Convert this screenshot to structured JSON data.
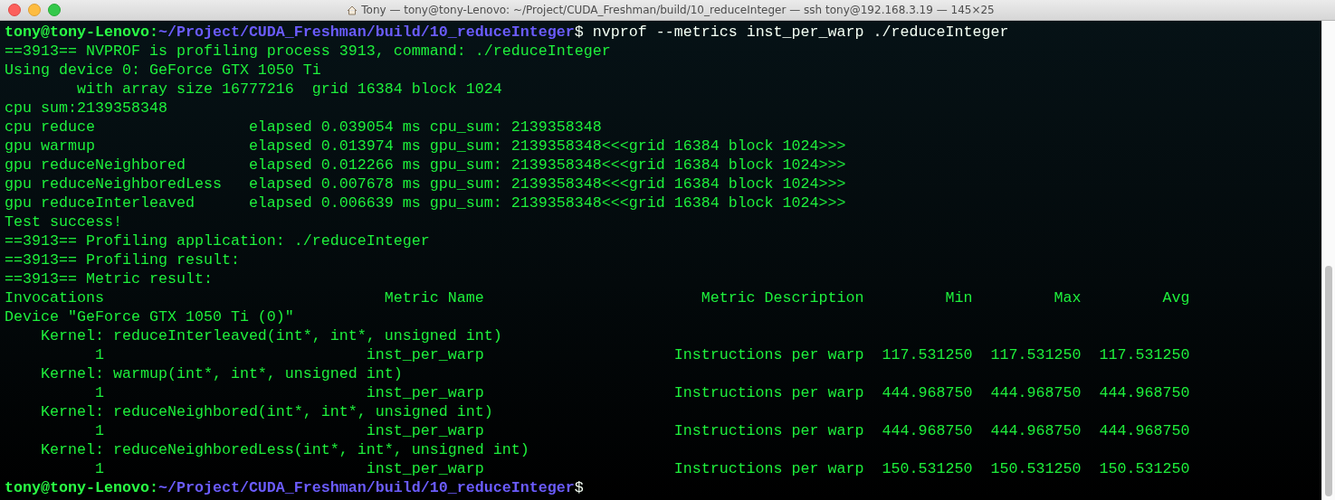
{
  "window": {
    "title": "Tony — tony@tony-Lenovo: ~/Project/CUDA_Freshman/build/10_reduceInteger — ssh tony@192.168.3.19 — 145×25"
  },
  "lines": [
    {
      "kind": "prompt",
      "user_host": "tony@tony-Lenovo:",
      "path": "~/Project/CUDA_Freshman/build/10_reduceInteger",
      "command": "$ nvprof --metrics inst_per_warp ./reduceInteger"
    },
    {
      "kind": "output",
      "text": "==3913== NVPROF is profiling process 3913, command: ./reduceInteger"
    },
    {
      "kind": "output",
      "text": "Using device 0: GeForce GTX 1050 Ti"
    },
    {
      "kind": "output",
      "text": "        with array size 16777216  grid 16384 block 1024"
    },
    {
      "kind": "output",
      "text": "cpu sum:2139358348"
    },
    {
      "kind": "output",
      "text": "cpu reduce                 elapsed 0.039054 ms cpu_sum: 2139358348"
    },
    {
      "kind": "output",
      "text": "gpu warmup                 elapsed 0.013974 ms gpu_sum: 2139358348<<<grid 16384 block 1024>>>"
    },
    {
      "kind": "output",
      "text": "gpu reduceNeighbored       elapsed 0.012266 ms gpu_sum: 2139358348<<<grid 16384 block 1024>>>"
    },
    {
      "kind": "output",
      "text": "gpu reduceNeighboredLess   elapsed 0.007678 ms gpu_sum: 2139358348<<<grid 16384 block 1024>>>"
    },
    {
      "kind": "output",
      "text": "gpu reduceInterleaved      elapsed 0.006639 ms gpu_sum: 2139358348<<<grid 16384 block 1024>>>"
    },
    {
      "kind": "output",
      "text": "Test success!"
    },
    {
      "kind": "output",
      "text": "==3913== Profiling application: ./reduceInteger"
    },
    {
      "kind": "output",
      "text": "==3913== Profiling result:"
    },
    {
      "kind": "output",
      "text": "==3913== Metric result:"
    },
    {
      "kind": "output",
      "text": "Invocations                               Metric Name                        Metric Description         Min         Max         Avg"
    },
    {
      "kind": "output",
      "text": "Device \"GeForce GTX 1050 Ti (0)\""
    },
    {
      "kind": "output",
      "text": "    Kernel: reduceInterleaved(int*, int*, unsigned int)"
    },
    {
      "kind": "output",
      "text": "          1                             inst_per_warp                     Instructions per warp  117.531250  117.531250  117.531250"
    },
    {
      "kind": "output",
      "text": "    Kernel: warmup(int*, int*, unsigned int)"
    },
    {
      "kind": "output",
      "text": "          1                             inst_per_warp                     Instructions per warp  444.968750  444.968750  444.968750"
    },
    {
      "kind": "output",
      "text": "    Kernel: reduceNeighbored(int*, int*, unsigned int)"
    },
    {
      "kind": "output",
      "text": "          1                             inst_per_warp                     Instructions per warp  444.968750  444.968750  444.968750"
    },
    {
      "kind": "output",
      "text": "    Kernel: reduceNeighboredLess(int*, int*, unsigned int)"
    },
    {
      "kind": "output",
      "text": "          1                             inst_per_warp                     Instructions per warp  150.531250  150.531250  150.531250"
    },
    {
      "kind": "prompt",
      "user_host": "tony@tony-Lenovo:",
      "path": "~/Project/CUDA_Freshman/build/10_reduceInteger",
      "command": "$"
    }
  ]
}
